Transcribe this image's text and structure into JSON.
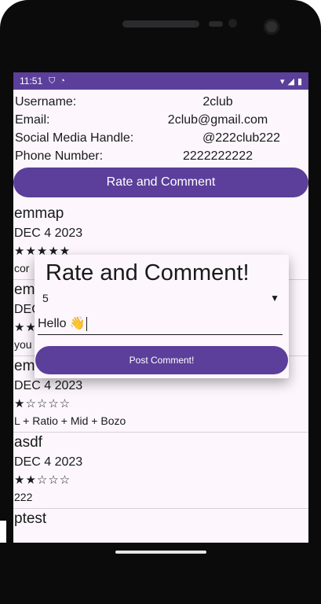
{
  "status_bar": {
    "time": "11:51",
    "icons": [
      "shield-icon",
      "sync-icon"
    ],
    "right_icons": [
      "wifi-icon",
      "signal-icon",
      "battery-icon"
    ]
  },
  "profile": {
    "username_label": "Username:",
    "username_value": "2club",
    "email_label": "Email:",
    "email_value": "2club@gmail.com",
    "social_label": "Social Media Handle:",
    "social_value": "@222club222",
    "phone_label": "Phone Number:",
    "phone_value": "2222222222"
  },
  "rate_button_label": "Rate and Comment",
  "reviews": [
    {
      "name": "emmap",
      "date": "DEC 4 2023",
      "stars": "★★★★★",
      "comment": "cor"
    },
    {
      "name": "em",
      "date": "DEC",
      "stars": "★★",
      "comment": "you"
    },
    {
      "name": "emmap",
      "date": "DEC 4 2023",
      "stars": "★☆☆☆☆",
      "comment": "L + Ratio + Mid + Bozo"
    },
    {
      "name": "asdf",
      "date": "DEC 4 2023",
      "stars": "★★☆☆☆",
      "comment": "222"
    },
    {
      "name": "ptest",
      "date": "",
      "stars": "",
      "comment": ""
    }
  ],
  "dialog": {
    "title": "Rate and Comment!",
    "rating_value": "5",
    "comment_value": "Hello 👋",
    "post_label": "Post Comment!"
  },
  "colors": {
    "accent": "#5b3f9a",
    "background": "#fdf7fd"
  }
}
